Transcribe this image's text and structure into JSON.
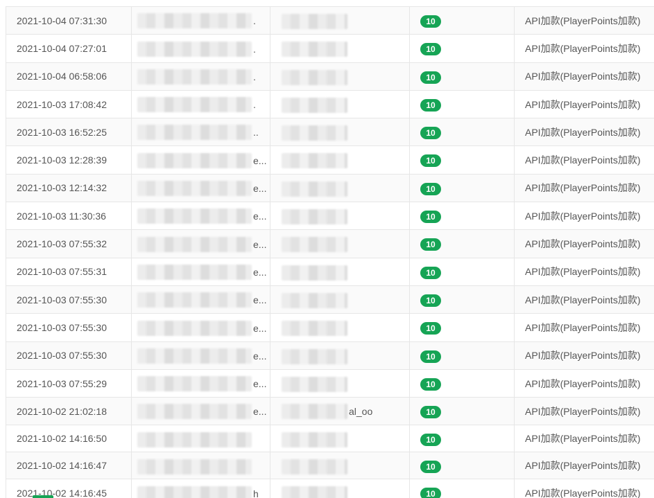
{
  "table": {
    "rows": [
      {
        "time": "2021-10-04 07:31:30",
        "account_tail": ".",
        "player_tail": "",
        "amount": "10",
        "source": "API加款(PlayerPoints加款)"
      },
      {
        "time": "2021-10-04 07:27:01",
        "account_tail": ".",
        "player_tail": "",
        "amount": "10",
        "source": "API加款(PlayerPoints加款)"
      },
      {
        "time": "2021-10-04 06:58:06",
        "account_tail": ".",
        "player_tail": "",
        "amount": "10",
        "source": "API加款(PlayerPoints加款)"
      },
      {
        "time": "2021-10-03 17:08:42",
        "account_tail": ".",
        "player_tail": "",
        "amount": "10",
        "source": "API加款(PlayerPoints加款)"
      },
      {
        "time": "2021-10-03 16:52:25",
        "account_tail": "..",
        "player_tail": "",
        "amount": "10",
        "source": "API加款(PlayerPoints加款)"
      },
      {
        "time": "2021-10-03 12:28:39",
        "account_tail": "e...",
        "player_tail": "",
        "amount": "10",
        "source": "API加款(PlayerPoints加款)"
      },
      {
        "time": "2021-10-03 12:14:32",
        "account_tail": "e...",
        "player_tail": "",
        "amount": "10",
        "source": "API加款(PlayerPoints加款)"
      },
      {
        "time": "2021-10-03 11:30:36",
        "account_tail": "e...",
        "player_tail": "",
        "amount": "10",
        "source": "API加款(PlayerPoints加款)"
      },
      {
        "time": "2021-10-03 07:55:32",
        "account_tail": "e...",
        "player_tail": "",
        "amount": "10",
        "source": "API加款(PlayerPoints加款)"
      },
      {
        "time": "2021-10-03 07:55:31",
        "account_tail": "e...",
        "player_tail": "",
        "amount": "10",
        "source": "API加款(PlayerPoints加款)"
      },
      {
        "time": "2021-10-03 07:55:30",
        "account_tail": "e...",
        "player_tail": "",
        "amount": "10",
        "source": "API加款(PlayerPoints加款)"
      },
      {
        "time": "2021-10-03 07:55:30",
        "account_tail": "e...",
        "player_tail": "",
        "amount": "10",
        "source": "API加款(PlayerPoints加款)"
      },
      {
        "time": "2021-10-03 07:55:30",
        "account_tail": "e...",
        "player_tail": "",
        "amount": "10",
        "source": "API加款(PlayerPoints加款)"
      },
      {
        "time": "2021-10-03 07:55:29",
        "account_tail": "e...",
        "player_tail": "",
        "amount": "10",
        "source": "API加款(PlayerPoints加款)"
      },
      {
        "time": "2021-10-02 21:02:18",
        "account_tail": "e...",
        "player_tail": "al_oo",
        "amount": "10",
        "source": "API加款(PlayerPoints加款)"
      },
      {
        "time": "2021-10-02 14:16:50",
        "account_tail": "",
        "player_tail": "",
        "amount": "10",
        "source": "API加款(PlayerPoints加款)"
      },
      {
        "time": "2021-10-02 14:16:47",
        "account_tail": "",
        "player_tail": "",
        "amount": "10",
        "source": "API加款(PlayerPoints加款)"
      },
      {
        "time": "2021-10-02 14:16:45",
        "account_tail": "h",
        "player_tail": "",
        "amount": "10",
        "source": "API加款(PlayerPoints加款)"
      }
    ]
  },
  "colors": {
    "badge": "#16a455",
    "row_stripe": "#fafafa",
    "border": "#e6e6e6"
  }
}
